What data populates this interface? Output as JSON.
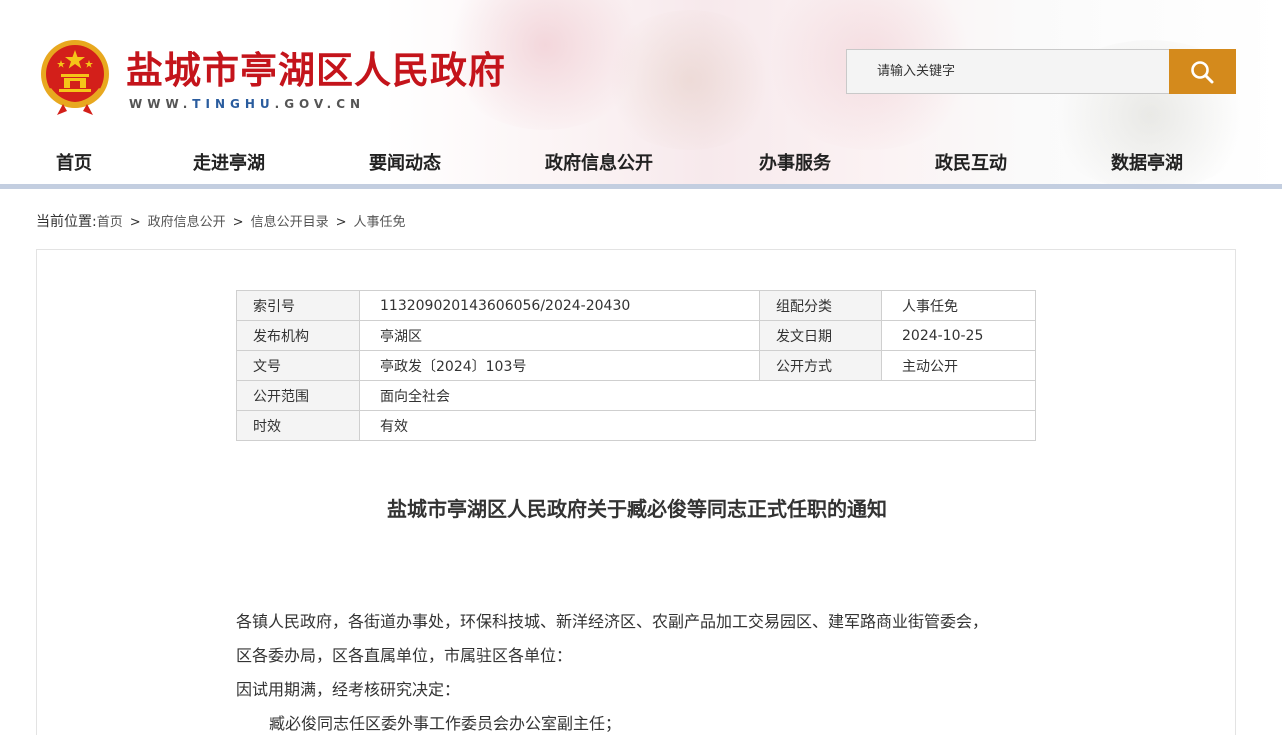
{
  "site": {
    "title": "盐城市亭湖区人民政府",
    "url_prefix": "WWW.",
    "url_highlight": "TINGHU",
    "url_suffix": ".GOV.CN"
  },
  "search": {
    "placeholder": "请输入关键字",
    "icon": "search-icon"
  },
  "nav": [
    {
      "label": "首页"
    },
    {
      "label": "走进亭湖"
    },
    {
      "label": "要闻动态"
    },
    {
      "label": "政府信息公开"
    },
    {
      "label": "办事服务"
    },
    {
      "label": "政民互动"
    },
    {
      "label": "数据亭湖"
    }
  ],
  "breadcrumb": {
    "lead": "当前位置:",
    "items": [
      "首页",
      "政府信息公开",
      "信息公开目录",
      "人事任免"
    ],
    "separator": ">"
  },
  "meta": {
    "index_label": "索引号",
    "index_value": "113209020143606056/2024-20430",
    "category_label": "组配分类",
    "category_value": "人事任免",
    "publisher_label": "发布机构",
    "publisher_value": "亭湖区",
    "date_label": "发文日期",
    "date_value": "2024-10-25",
    "docno_label": "文号",
    "docno_value": "亭政发〔2024〕103号",
    "mode_label": "公开方式",
    "mode_value": "主动公开",
    "scope_label": "公开范围",
    "scope_value": "面向全社会",
    "validity_label": "时效",
    "validity_value": "有效"
  },
  "document": {
    "title": "盐城市亭湖区人民政府关于臧必俊等同志正式任职的通知",
    "paragraphs": [
      "各镇人民政府，各街道办事处，环保科技城、新洋经济区、农副产品加工交易园区、建军路商业街管委会，",
      "区各委办局，区各直属单位，市属驻区各单位：",
      "因试用期满，经考核研究决定：",
      "臧必俊同志任区委外事工作委员会办公室副主任；"
    ]
  },
  "colors": {
    "title_red": "#c4141b",
    "search_button": "#d48a1c",
    "nav_underline": "#c3cee0",
    "url_blue": "#2a5c9e"
  }
}
